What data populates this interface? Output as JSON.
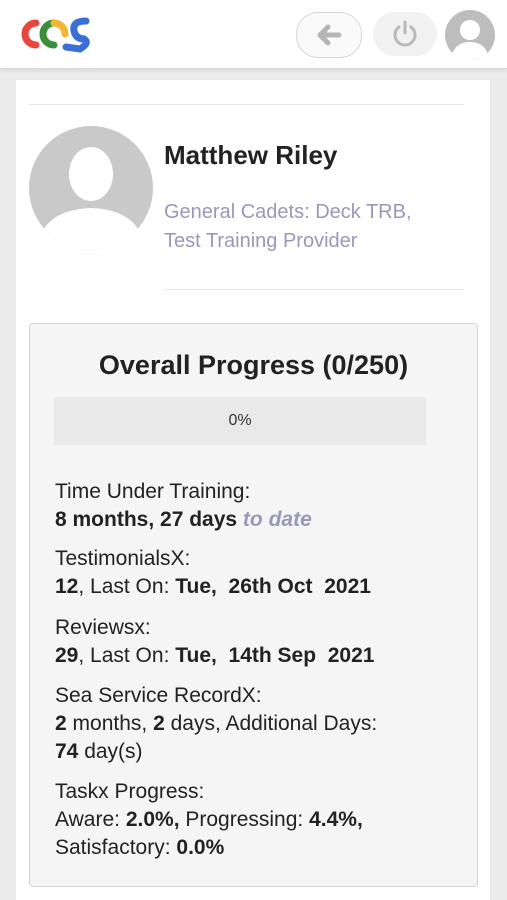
{
  "header": {
    "logo_icon": "acs-logo",
    "back_icon": "arrow-left-icon",
    "power_icon": "power-icon",
    "avatar_icon": "user-avatar-icon",
    "logo_colors": [
      "#e8453c",
      "#3a8f3a",
      "#f2b632",
      "#3b6fd8"
    ]
  },
  "profile": {
    "name": "Matthew Riley",
    "subtitle_line1": "General Cadets: Deck TRB,",
    "subtitle_line2": "Test Training Provider"
  },
  "progress": {
    "title": "Overall Progress (0/250)",
    "percent_label": "0%",
    "percent_value": 0
  },
  "stats": {
    "time_label": "Time Under Training:",
    "time_value": "8 months, 27 days",
    "time_suffix": "to date",
    "testimonials_label": "TestimonialsX:",
    "testimonials_count": "12",
    "testimonials_last_prefix": ", Last On: ",
    "testimonials_last_date": "Tue,  26th Oct  2021",
    "reviews_label": "Reviewsx:",
    "reviews_count": "29",
    "reviews_last_prefix": ", Last On: ",
    "reviews_last_date": "Tue,  14th Sep  2021",
    "sea_label": "Sea Service RecordX:",
    "sea_months": "2",
    "sea_months_text": " months, ",
    "sea_days": "2",
    "sea_days_text": " days, Additional Days:",
    "sea_additional": "74",
    "sea_additional_text": " day(s)",
    "task_label": "Taskx Progress:",
    "aware_label": "Aware: ",
    "aware_value": "2.0%,",
    "progressing_label": " Progressing: ",
    "progressing_value": "4.4%,",
    "satisfactory_label": "Satisfactory: ",
    "satisfactory_value": "0.0%"
  }
}
